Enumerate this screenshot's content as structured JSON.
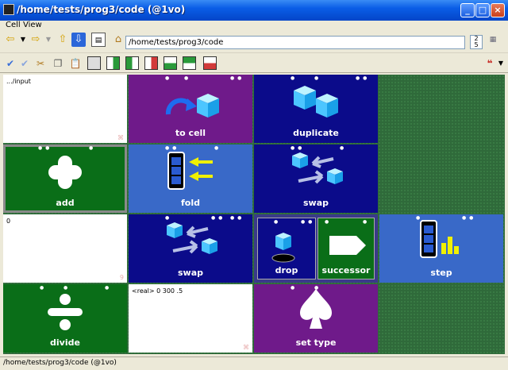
{
  "window": {
    "title": "/home/tests/prog3/code (@1vo)"
  },
  "menu": {
    "items": [
      "Cell",
      "View"
    ]
  },
  "nav": {
    "path": "/home/tests/prog3/code",
    "zoom_top": "2",
    "zoom_bottom": "5"
  },
  "cells": [
    {
      "kind": "text",
      "text": ".../input",
      "mark": "⌘"
    },
    {
      "kind": "op",
      "label": "to cell",
      "icon": "to-cell-icon"
    },
    {
      "kind": "op",
      "label": "duplicate",
      "icon": "duplicate-icon"
    },
    {
      "kind": "op",
      "label": "add",
      "icon": "plus-icon"
    },
    {
      "kind": "op",
      "label": "fold",
      "icon": "fold-icon"
    },
    {
      "kind": "op",
      "label": "swap",
      "icon": "swap-icon"
    },
    {
      "kind": "text",
      "text": "0",
      "mark": "9"
    },
    {
      "kind": "op",
      "label": "swap",
      "icon": "swap-icon"
    },
    {
      "kind": "op",
      "label": "drop",
      "icon": "drop-icon"
    },
    {
      "kind": "op",
      "label": "successor",
      "icon": "successor-icon"
    },
    {
      "kind": "op",
      "label": "step",
      "icon": "step-icon"
    },
    {
      "kind": "op",
      "label": "divide",
      "icon": "divide-icon"
    },
    {
      "kind": "text",
      "text": "<real> 0 300 .5",
      "mark": "⌘"
    },
    {
      "kind": "op",
      "label": "set type",
      "icon": "spade-icon"
    }
  ],
  "status": {
    "text": "/home/tests/prog3/code (@1vo)"
  },
  "colors": {
    "purple": "#6f1a8a",
    "navy": "#0b0b8a",
    "blue": "#3969c8",
    "green": "#0a6e18",
    "felt": "#2f6a3a"
  }
}
